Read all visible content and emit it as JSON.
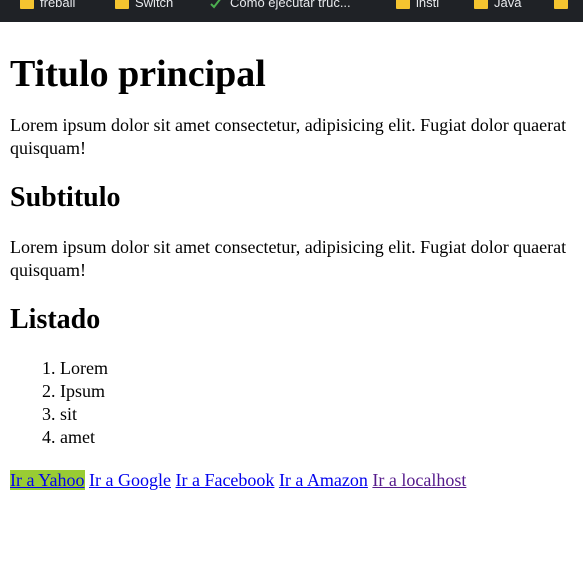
{
  "bookmarks": [
    {
      "label": "freball",
      "icon": "folder-icon"
    },
    {
      "label": "Switch",
      "icon": "folder-icon"
    },
    {
      "label": "Como ejecutar truc...",
      "icon": "check-icon"
    },
    {
      "label": "insti",
      "icon": "folder-icon"
    },
    {
      "label": "Java",
      "icon": "folder-icon"
    },
    {
      "label": "",
      "icon": "folder-icon"
    }
  ],
  "page": {
    "title": "Titulo principal",
    "paragraph1": "Lorem ipsum dolor sit amet consectetur, adipisicing elit. Fugiat dolor quaerat quisquam!",
    "subtitle": "Subtitulo",
    "paragraph2": "Lorem ipsum dolor sit amet consectetur, adipisicing elit. Fugiat dolor quaerat quisquam!",
    "list_heading": "Listado",
    "list_items": [
      "Lorem",
      "Ipsum",
      "sit",
      "amet"
    ],
    "links": [
      {
        "label": "Ir a Yahoo",
        "state": "highlighted"
      },
      {
        "label": "Ir a Google",
        "state": "normal"
      },
      {
        "label": "Ir a Facebook",
        "state": "normal"
      },
      {
        "label": "Ir a Amazon",
        "state": "normal"
      },
      {
        "label": "Ir a localhost",
        "state": "visited"
      }
    ]
  },
  "colors": {
    "bookmarks_bar": "#1f2226",
    "link": "#0000ee",
    "link_visited": "#551a8b",
    "link_highlight": "#99cc33",
    "folder": "#f4c430"
  }
}
